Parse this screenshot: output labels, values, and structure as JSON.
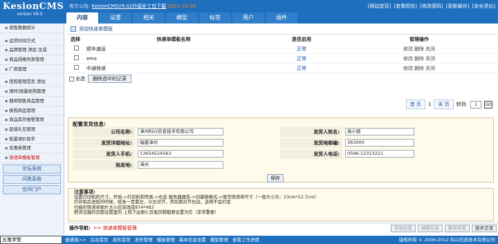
{
  "app": {
    "title": "KesionCMS",
    "version": "version V9.0"
  },
  "notice": {
    "label": "官方公告:",
    "link": "KesionCMSV9.02升级补丁包下载",
    "date": "2011-12-05"
  },
  "toplinks": [
    "[网站首页]",
    "[查看短信]",
    "[修改密码]",
    "[更新缓存]",
    "[安全退出]"
  ],
  "tabs": [
    "内容",
    "设置",
    "相关",
    "模型",
    "标签",
    "用户",
    "插件"
  ],
  "sidebar": {
    "items": [
      "销售数据统计",
      "运货时间方式",
      "品牌管理 添加 生成",
      "商品规格列表管理",
      "厂商管理",
      "团购管理首页 添加",
      "限时/限量抢购管理",
      "捆绑销售商品管理",
      "换购商品管理",
      "商品库存报警管理",
      "超值礼包管理",
      "批量调价助手",
      "优惠券管理",
      "快递单模板管理"
    ],
    "buttons": [
      "论坛系统",
      "问答系统",
      "空间门户"
    ]
  },
  "main": {
    "add_link": "添加快递单模板",
    "columns": [
      "选择",
      "快递单模板名称",
      "是否启用",
      "管理操作"
    ],
    "rows": [
      {
        "name": "顺丰速运",
        "status": "正常",
        "ops": [
          "修改",
          "删除",
          "关闭"
        ]
      },
      {
        "name": "ems",
        "status": "正常",
        "ops": [
          "修改",
          "删除",
          "关闭"
        ]
      },
      {
        "name": "中通快递",
        "status": "正常",
        "ops": [
          "修改",
          "删除",
          "关闭"
        ]
      }
    ],
    "select_all": "全选",
    "delete_selected": "删除选中的记录",
    "pager": {
      "first": "首 页",
      "page": "1",
      "last": "末 页",
      "goto": "转到:",
      "go": "GO"
    }
  },
  "config": {
    "title": "配置发货信息:",
    "fields": {
      "company_label": "公司名称:",
      "company": "漳州科兴信息技术有限公司",
      "sender_label": "发货人姓名:",
      "sender": "高小姐",
      "address_label": "发货详细地址:",
      "address": "福建漳州",
      "zip_label": "发货地邮编:",
      "zip": "363000",
      "mobile_label": "发货人手机:",
      "mobile": "13654524563",
      "phone_label": "发货人电话:",
      "phone": "0596-12313221",
      "origin_label": "始发地:",
      "origin": "漳州"
    },
    "save": "保存"
  },
  "notes": {
    "title": "注意事项:",
    "lines": [
      "设置打印机的尺寸，开始->打印机和传真->右击 服务器属性->创建新格式->填写快递单尺寸（一般大小为：23cm*12.7cm）",
      "打印机后进纸的时候，纸张一定靠左，以左对齐，然后再对齐右边，这样不会打歪",
      "扫描的快递单图片大小应该改成874*483",
      "把浏览器的页面设置里的 上和下边距0,页眉页脚都要设置为空（非常重要）"
    ]
  },
  "bottom": {
    "label": "操作导航:",
    "crumb": ">> 快递单模板管理",
    "buttons": [
      "添加信息",
      "编辑信息",
      "删除信息",
      "技术交流"
    ]
  },
  "footer": {
    "ime": "五笔字型",
    "links": [
      "速通道>>",
      "后台首页",
      "发布首页",
      "发布管理",
      "模板管理",
      "基本信息设置",
      "模型管理",
      "查看工作进度"
    ],
    "copyright": "版权所有 © 2006-2012 科兴信息技术有限公司"
  }
}
